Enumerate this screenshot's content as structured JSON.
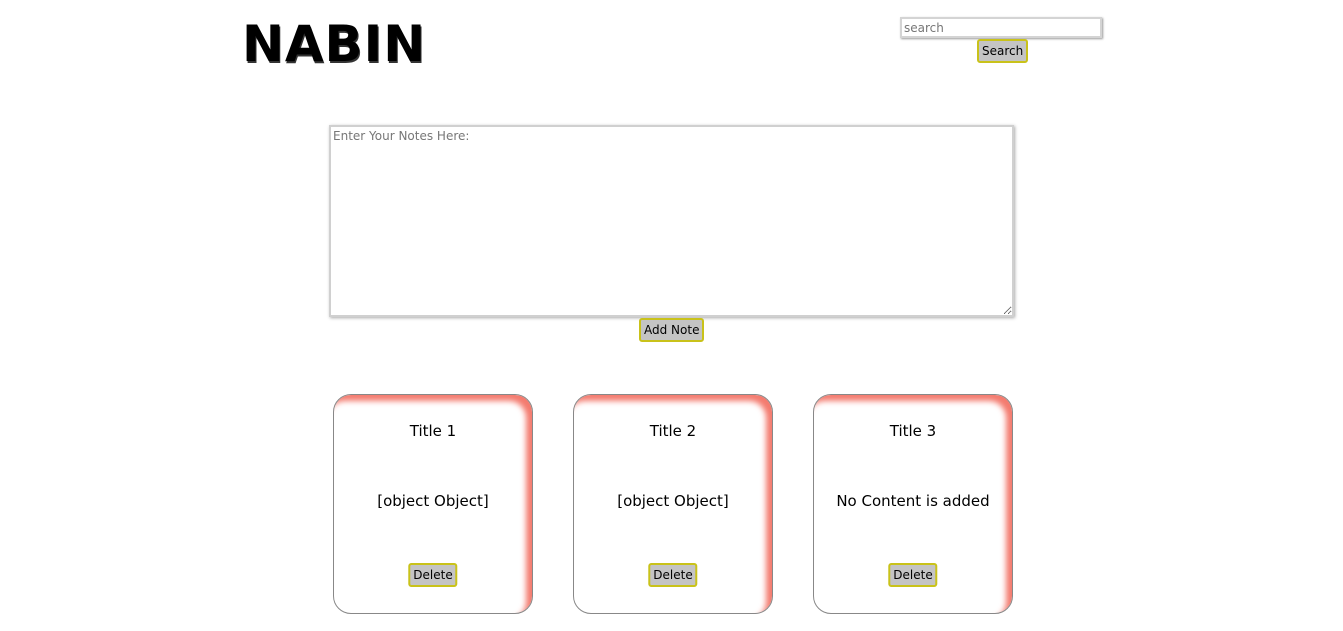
{
  "header": {
    "logo_text": "NABIN",
    "search_placeholder": "search",
    "search_button_label": "Search"
  },
  "editor": {
    "notes_placeholder": "Enter Your Notes Here:",
    "add_button_label": "Add Note"
  },
  "notes": [
    {
      "title": "Title 1",
      "content": "[object Object]",
      "delete_label": "Delete"
    },
    {
      "title": "Title 2",
      "content": "[object Object]",
      "delete_label": "Delete"
    },
    {
      "title": "Title 3",
      "content": "No Content is added",
      "delete_label": "Delete"
    }
  ],
  "colors": {
    "button_bg": "#c4c4c4",
    "button_border": "#c9c21a",
    "card_accent": "#f47b6f"
  }
}
